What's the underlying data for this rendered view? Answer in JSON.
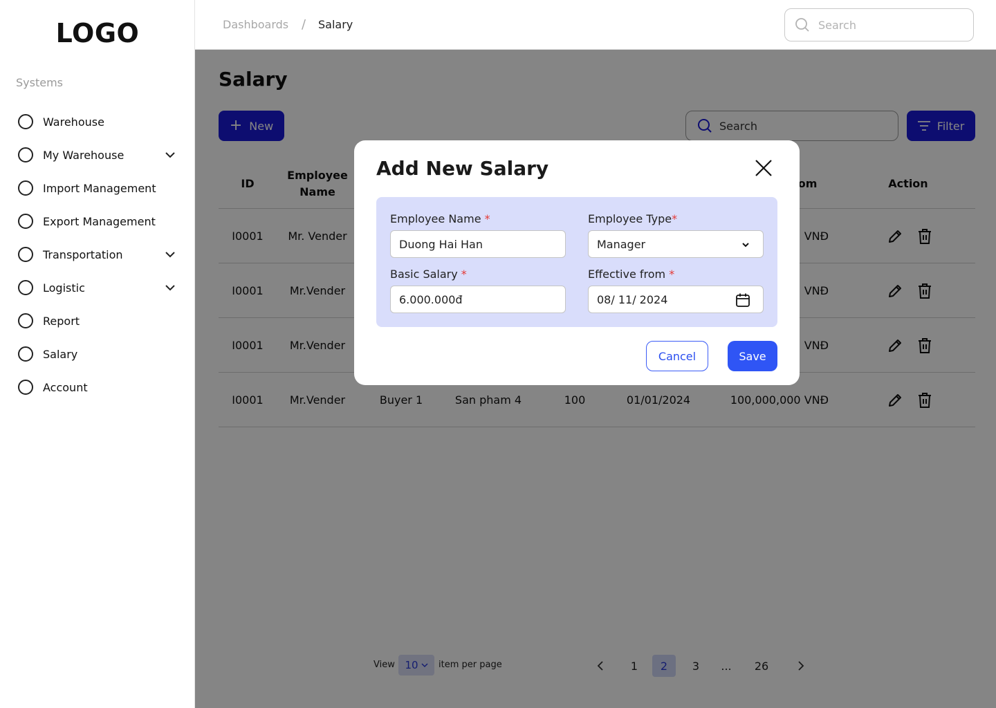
{
  "logo": "LOGO",
  "sidebar": {
    "section_label": "Systems",
    "items": [
      {
        "label": "Warehouse",
        "has_chevron": false
      },
      {
        "label": "My Warehouse",
        "has_chevron": true
      },
      {
        "label": "Import Management",
        "has_chevron": false
      },
      {
        "label": "Export Management",
        "has_chevron": false
      },
      {
        "label": "Transportation",
        "has_chevron": true
      },
      {
        "label": "Logistic",
        "has_chevron": true
      },
      {
        "label": "Report",
        "has_chevron": false
      },
      {
        "label": "Salary",
        "has_chevron": false
      },
      {
        "label": "Account",
        "has_chevron": false
      }
    ]
  },
  "header": {
    "breadcrumb": [
      "Dashboards",
      "Salary"
    ],
    "breadcrumb_sep": "/",
    "search_placeholder": "Search"
  },
  "main": {
    "title": "Salary",
    "new_button": "New",
    "search_placeholder": "Search",
    "filter_button": "Filter",
    "table": {
      "columns": [
        "ID",
        "Employee Name",
        "From",
        "Action"
      ],
      "rows": [
        {
          "id": "I0001",
          "name": "Mr. Vender",
          "buyer": "",
          "product": "",
          "qty": "",
          "date": "",
          "amount": "VNĐ"
        },
        {
          "id": "I0001",
          "name": "Mr.Vender",
          "buyer": "",
          "product": "",
          "qty": "",
          "date": "",
          "amount": "VNĐ"
        },
        {
          "id": "I0001",
          "name": "Mr.Vender",
          "buyer": "",
          "product": "",
          "qty": "",
          "date": "",
          "amount": "VNĐ"
        },
        {
          "id": "I0001",
          "name": "Mr.Vender",
          "buyer": "Buyer 1",
          "product": "San pham 4",
          "qty": "100",
          "date": "01/01/2024",
          "amount": "100,000,000 VNĐ"
        }
      ]
    },
    "pagination": {
      "view_label": "View",
      "per_page": "10",
      "per_page_label": "item per page",
      "pages": [
        "1",
        "2",
        "3",
        "...",
        "26"
      ],
      "current_page": "2"
    }
  },
  "modal": {
    "title": "Add New Salary",
    "fields": {
      "employee_name": {
        "label": "Employee Name",
        "required": "*",
        "value": "Duong Hai Han"
      },
      "employee_type": {
        "label": "Employee Type",
        "required": "*",
        "value": "Manager"
      },
      "basic_salary": {
        "label": "Basic Salary",
        "required": "*",
        "value": "6.000.000đ"
      },
      "effective_from": {
        "label": "Effective from",
        "required": "*",
        "value": "08/ 11/ 2024"
      }
    },
    "cancel_button": "Cancel",
    "save_button": "Save"
  },
  "colors": {
    "primary": "#1a1ad6",
    "save": "#2f55f5",
    "form_bg": "#d9ddfb",
    "overlay": "rgba(0,0,0,0.48)",
    "required": "#e53935"
  }
}
